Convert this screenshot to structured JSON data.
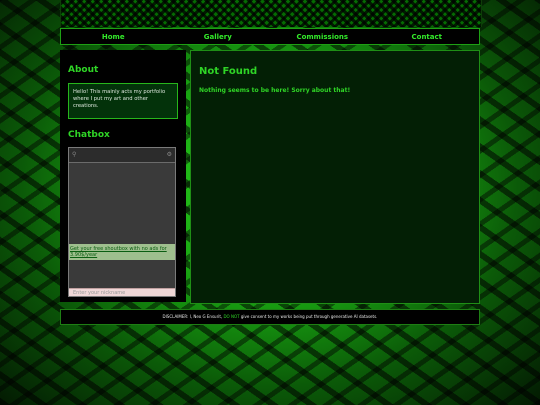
{
  "nav": {
    "items": [
      "Home",
      "Gallery",
      "Commissions",
      "Contact"
    ]
  },
  "sidebar": {
    "about_title": "About",
    "about_text": "Hello! This mainly acts my portfolio where I put my art and other creations.",
    "chat_title": "Chatbox",
    "chat_promo": "Get your free shoutbox with no ads for 3.90$/year",
    "nickname_placeholder": "Enter your nickname"
  },
  "main": {
    "title": "Not Found",
    "message": "Nothing seems to be here! Sorry about that!"
  },
  "footer": {
    "text_before": "DISCLAIMER: I, Neo G Ensurit,",
    "highlight": "DO NOT",
    "text_after": "give consent to my works being put through generative AI datasets."
  },
  "colors": {
    "accent": "#2fd526",
    "panel": "#000000",
    "main_bg": "#031f05"
  }
}
